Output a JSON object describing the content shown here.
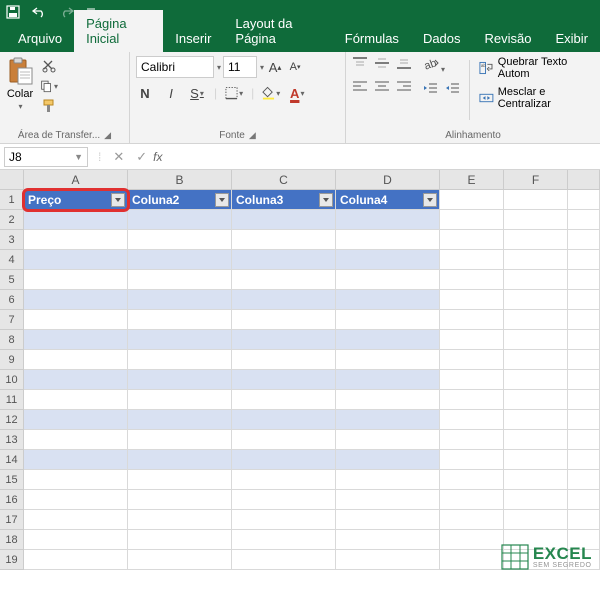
{
  "titlebar": {},
  "tabs": {
    "arquivo": "Arquivo",
    "inicial": "Página Inicial",
    "inserir": "Inserir",
    "layout": "Layout da Página",
    "formulas": "Fórmulas",
    "dados": "Dados",
    "revisao": "Revisão",
    "exibir": "Exibir"
  },
  "ribbon": {
    "clipboard": {
      "colar": "Colar",
      "group": "Área de Transfer..."
    },
    "font": {
      "name": "Calibri",
      "size": "11",
      "bold": "N",
      "italic": "I",
      "underline": "S",
      "group": "Fonte"
    },
    "align": {
      "wrap": "Quebrar Texto Autom",
      "merge": "Mesclar e Centralizar",
      "group": "Alinhamento"
    }
  },
  "namebox": {
    "ref": "J8",
    "fx": "fx"
  },
  "columns": [
    "A",
    "B",
    "C",
    "D",
    "E",
    "F"
  ],
  "table": {
    "headers": [
      "Preço",
      "Coluna2",
      "Coluna3",
      "Coluna4"
    ]
  },
  "rows": [
    1,
    2,
    3,
    4,
    5,
    6,
    7,
    8,
    9,
    10,
    11,
    12,
    13,
    14,
    15,
    16,
    17,
    18,
    19
  ],
  "watermark": {
    "main": "EXCEL",
    "sub": "SEM SEGREDO"
  }
}
